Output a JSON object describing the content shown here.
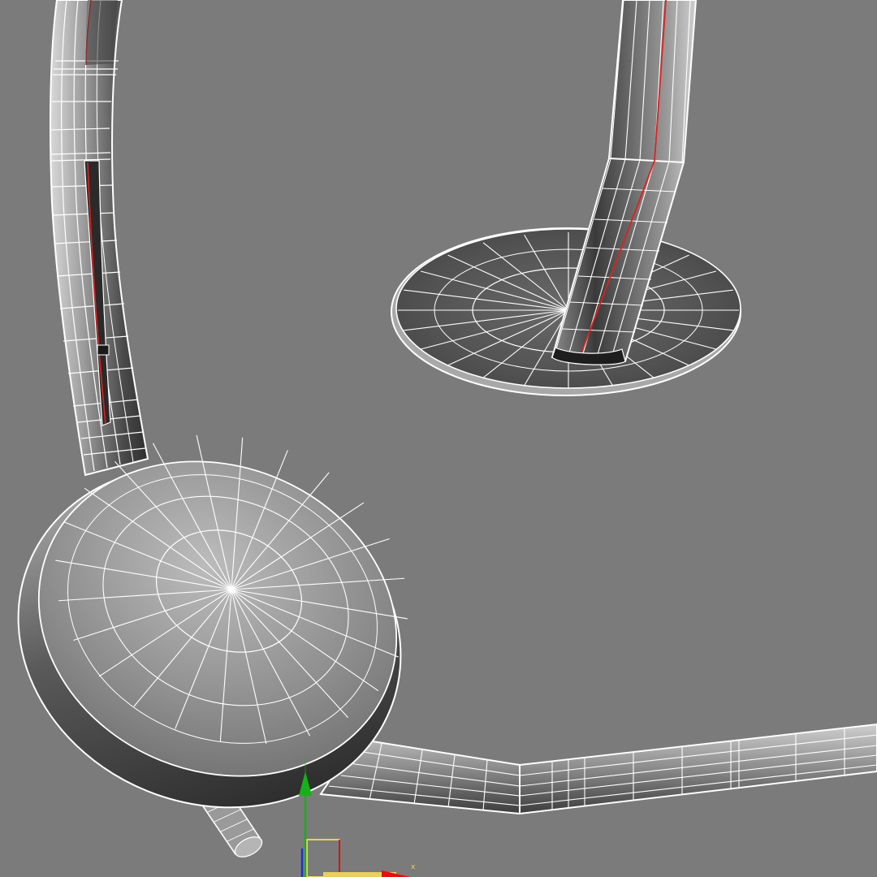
{
  "viewport": {
    "background": "#7b7b7b",
    "wire_color": "#ffffff",
    "selection_edge_color": "#e02020",
    "shade_dark": "#2a2a2a",
    "shade_light": "#bdbdbd"
  },
  "gizmo": {
    "x_label": "x",
    "x_color": "#e01010",
    "y_color": "#18b018",
    "z_color": "#2030d0",
    "plane_color": "#e8d060"
  }
}
